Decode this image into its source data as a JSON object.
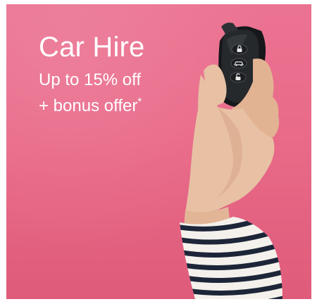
{
  "promo": {
    "title": "Car Hire",
    "line1": "Up to 15% off",
    "line2": "+ bonus offer",
    "line2_mark": "*"
  },
  "colors": {
    "background": "#e96a89",
    "text": "#ffffff",
    "key_body": "#26292c"
  },
  "icons": [
    "hand-holding-car-key",
    "lock-icon",
    "car-icon",
    "unlock-icon"
  ]
}
